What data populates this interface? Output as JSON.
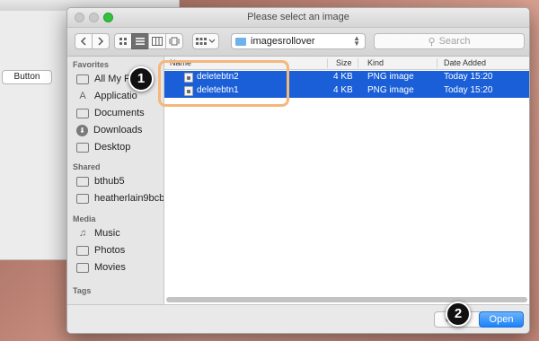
{
  "background_window": {
    "button_label": "Button"
  },
  "dialog": {
    "title": "Please select an image",
    "location": "imagesrollover",
    "search_placeholder": "Search",
    "columns": {
      "name": "Name",
      "size": "Size",
      "kind": "Kind",
      "date_added": "Date Added"
    },
    "files": [
      {
        "name": "deletebtn2",
        "size": "4 KB",
        "kind": "PNG image",
        "date_added": "Today 15:20",
        "selected": true
      },
      {
        "name": "deletebtn1",
        "size": "4 KB",
        "kind": "PNG image",
        "date_added": "Today 15:20",
        "selected": true
      }
    ],
    "cancel_label": "C",
    "open_label": "Open"
  },
  "sidebar": {
    "favorites": {
      "heading": "Favorites",
      "items": [
        {
          "label": "All My F",
          "icon": "all-my-files-icon"
        },
        {
          "label": "Applicatio",
          "icon": "applications-icon"
        },
        {
          "label": "Documents",
          "icon": "documents-icon"
        },
        {
          "label": "Downloads",
          "icon": "downloads-icon"
        },
        {
          "label": "Desktop",
          "icon": "desktop-icon"
        }
      ]
    },
    "shared": {
      "heading": "Shared",
      "items": [
        {
          "label": "bthub5",
          "icon": "computer-icon"
        },
        {
          "label": "heatherlain9bcb",
          "icon": "computer-icon"
        }
      ]
    },
    "media": {
      "heading": "Media",
      "items": [
        {
          "label": "Music",
          "icon": "music-icon"
        },
        {
          "label": "Photos",
          "icon": "camera-icon"
        },
        {
          "label": "Movies",
          "icon": "film-icon"
        }
      ]
    },
    "tags": {
      "heading": "Tags"
    }
  },
  "annotations": {
    "step1": "1",
    "step2": "2"
  },
  "colors": {
    "selection": "#1a5fd7",
    "open_button": "#1a82fb",
    "highlight": "#f4b77c",
    "callout": "#111111"
  }
}
